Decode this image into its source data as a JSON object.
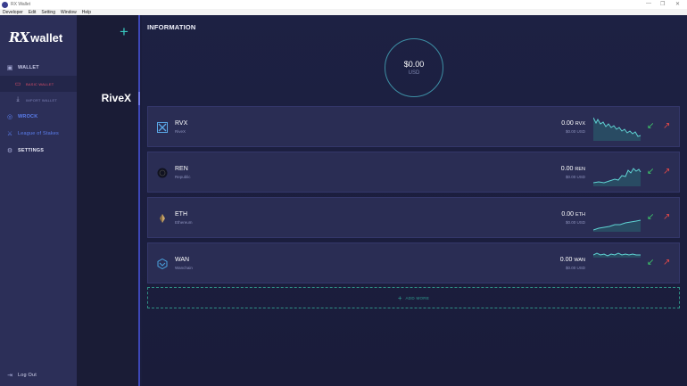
{
  "window": {
    "title": "RX Wallet",
    "controls": [
      "—",
      "❐",
      "✕"
    ]
  },
  "menu": [
    "Developer",
    "Edit",
    "Setting",
    "Window",
    "Help"
  ],
  "sidebar": {
    "logo_rx": "RX",
    "logo_text": "wallet",
    "wallet": "WALLET",
    "basic_wallet": "BASIC WALLET",
    "import_wallet": "IMPORT WALLET",
    "wrock": "WROCK",
    "league": "League of Stakes",
    "settings": "SETTINGS",
    "logout": "Log Out"
  },
  "wallet_column": {
    "add_symbol": "+",
    "selected_wallet": "RiveX"
  },
  "main": {
    "heading": "INFORMATION",
    "balance": {
      "amount": "$0.00",
      "unit": "USD"
    },
    "coins": [
      {
        "symbol": "RVX",
        "name": "RiveX",
        "balance": "0.00",
        "balance_symbol": "RVX",
        "usd": "$0.00 USD",
        "trend": "down"
      },
      {
        "symbol": "REN",
        "name": "Republic",
        "balance": "0.00",
        "balance_symbol": "REN",
        "usd": "$0.00 USD",
        "trend": "up"
      },
      {
        "symbol": "ETH",
        "name": "Ethereum",
        "balance": "0.00",
        "balance_symbol": "ETH",
        "usd": "$0.00 USD",
        "trend": "up"
      },
      {
        "symbol": "WAN",
        "name": "Wanchain",
        "balance": "0.00",
        "balance_symbol": "WAN",
        "usd": "$0.00 USD",
        "trend": "flat"
      }
    ],
    "add_more": "ADD MORE"
  },
  "colors": {
    "accent": "#39c9c0",
    "sidebar": "#2c2f58",
    "receive": "#3ec96a",
    "send": "#e04848",
    "active": "#e0506a"
  }
}
